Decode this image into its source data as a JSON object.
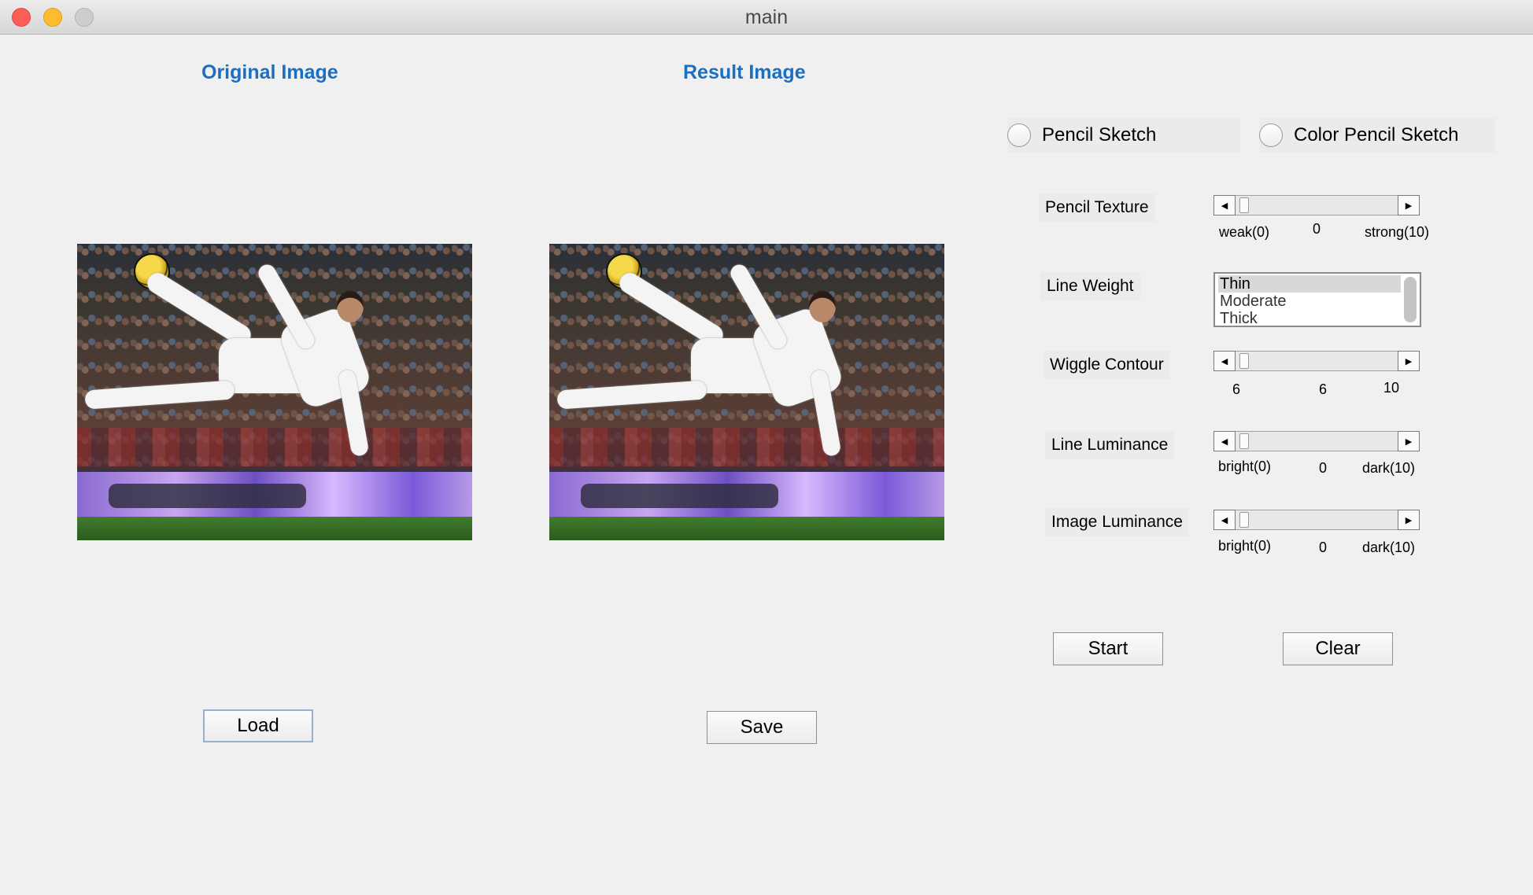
{
  "window": {
    "title": "main"
  },
  "panels": {
    "original": {
      "heading": "Original Image",
      "load_label": "Load"
    },
    "result": {
      "heading": "Result Image",
      "save_label": "Save"
    }
  },
  "modes": {
    "pencil_sketch": {
      "label": "Pencil Sketch",
      "selected": false
    },
    "color_pencil_sketch": {
      "label": "Color Pencil Sketch",
      "selected": false
    }
  },
  "controls": {
    "pencil_texture": {
      "label": "Pencil Texture",
      "min_label": "weak(0)",
      "value_label": "0",
      "max_label": "strong(10)",
      "value": 0
    },
    "line_weight": {
      "label": "Line Weight",
      "options": [
        "Thin",
        "Moderate",
        "Thick"
      ],
      "selected": "Thin"
    },
    "wiggle_contour": {
      "label": "Wiggle Contour",
      "min_label": "6",
      "value_label": "6",
      "max_label": "10",
      "value": 6
    },
    "line_luminance": {
      "label": "Line Luminance",
      "min_label": "bright(0)",
      "value_label": "0",
      "max_label": "dark(10)",
      "value": 0
    },
    "image_luminance": {
      "label": "Image Luminance",
      "min_label": "bright(0)",
      "value_label": "0",
      "max_label": "dark(10)",
      "value": 0
    }
  },
  "actions": {
    "start_label": "Start",
    "clear_label": "Clear"
  },
  "icons": {
    "slider_left": "◀",
    "slider_right": "▶"
  },
  "colors": {
    "heading": "#1a6fc1",
    "close": "#fd5d57",
    "minimize": "#fdbc2e",
    "zoom": "#cdcdcd"
  }
}
